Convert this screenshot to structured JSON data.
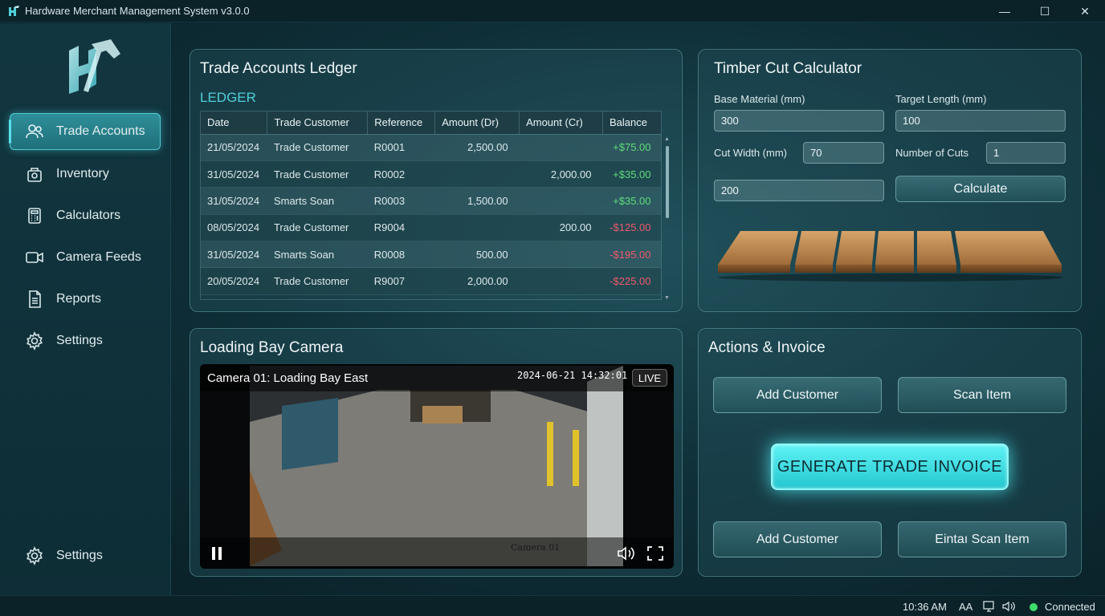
{
  "window": {
    "title": "Hardware Merchant Management System v3.0.0",
    "controls": {
      "minimize": "—",
      "maximize": "☐",
      "close": "✕"
    }
  },
  "sidebar": {
    "items": [
      {
        "label": "Trade Accounts",
        "icon": "users-icon",
        "active": true
      },
      {
        "label": "Inventory",
        "icon": "box-icon",
        "active": false
      },
      {
        "label": "Calculators",
        "icon": "calculator-icon",
        "active": false
      },
      {
        "label": "Camera Feeds",
        "icon": "video-camera-icon",
        "active": false
      },
      {
        "label": "Reports",
        "icon": "document-icon",
        "active": false
      },
      {
        "label": "Settings",
        "icon": "gear-icon",
        "active": false
      }
    ],
    "footer_item": {
      "label": "Settings",
      "icon": "gear-icon"
    }
  },
  "ledger": {
    "title": "Trade Accounts Ledger",
    "subtitle": "LEDGER",
    "columns": [
      "Date",
      "Trade Customer",
      "Reference",
      "Amount (Dr)",
      "Amount (Cr)",
      "Balance"
    ],
    "rows": [
      {
        "date": "21/05/2024",
        "customer": "Trade Customer",
        "ref": "R0001",
        "dr": "2,500.00",
        "cr": "",
        "balance": "+$75.00",
        "sign": "pos"
      },
      {
        "date": "31/05/2024",
        "customer": "Trade Customer",
        "ref": "R0002",
        "dr": "",
        "cr": "2,000.00",
        "balance": "+$35.00",
        "sign": "pos"
      },
      {
        "date": "31/05/2024",
        "customer": "Smarts Soan",
        "ref": "R0003",
        "dr": "1,500.00",
        "cr": "",
        "balance": "+$35.00",
        "sign": "pos"
      },
      {
        "date": "08/05/2024",
        "customer": "Trade Customer",
        "ref": "R9004",
        "dr": "",
        "cr": "200.00",
        "balance": "-$125.00",
        "sign": "neg"
      },
      {
        "date": "31/05/2024",
        "customer": "Smarts Soan",
        "ref": "R0008",
        "dr": "500.00",
        "cr": "",
        "balance": "-$195.00",
        "sign": "neg"
      },
      {
        "date": "20/05/2024",
        "customer": "Trade Customer",
        "ref": "R9007",
        "dr": "2,000.00",
        "cr": "",
        "balance": "-$225.00",
        "sign": "neg"
      }
    ]
  },
  "calculator": {
    "title": "Timber Cut Calculator",
    "base_material_label": "Base Material (mm)",
    "base_material_value": "300",
    "target_length_label": "Target Length (mm)",
    "target_length_value": "100",
    "cut_width_label": "Cut Width (mm)",
    "cut_width_value": "70",
    "num_cuts_label": "Number of Cuts",
    "num_cuts_value": "1",
    "result_value": "200",
    "calculate_label": "Calculate"
  },
  "camera": {
    "title": "Loading Bay Camera",
    "feed_name": "Camera 01: Loading Bay East",
    "timestamp": "2024-06-21 14:32:01",
    "live_label": "LIVE",
    "watermark": "Camera 01"
  },
  "actions": {
    "title": "Actions & Invoice",
    "add_customer_label": "Add Customer",
    "scan_item_label": "Scan Item",
    "generate_label": "GENERATE TRADE INVOICE",
    "add_customer_2_label": "Add Customer",
    "scan_item_2_label": "Eintaı Scan Item"
  },
  "status": {
    "time": "10:36 AM",
    "lang": "AA",
    "connection": "Connected",
    "connection_color": "#3ddc6a"
  },
  "colors": {
    "accent": "#4fd0d8",
    "positive": "#5fdc7a",
    "negative": "#f0596a"
  }
}
